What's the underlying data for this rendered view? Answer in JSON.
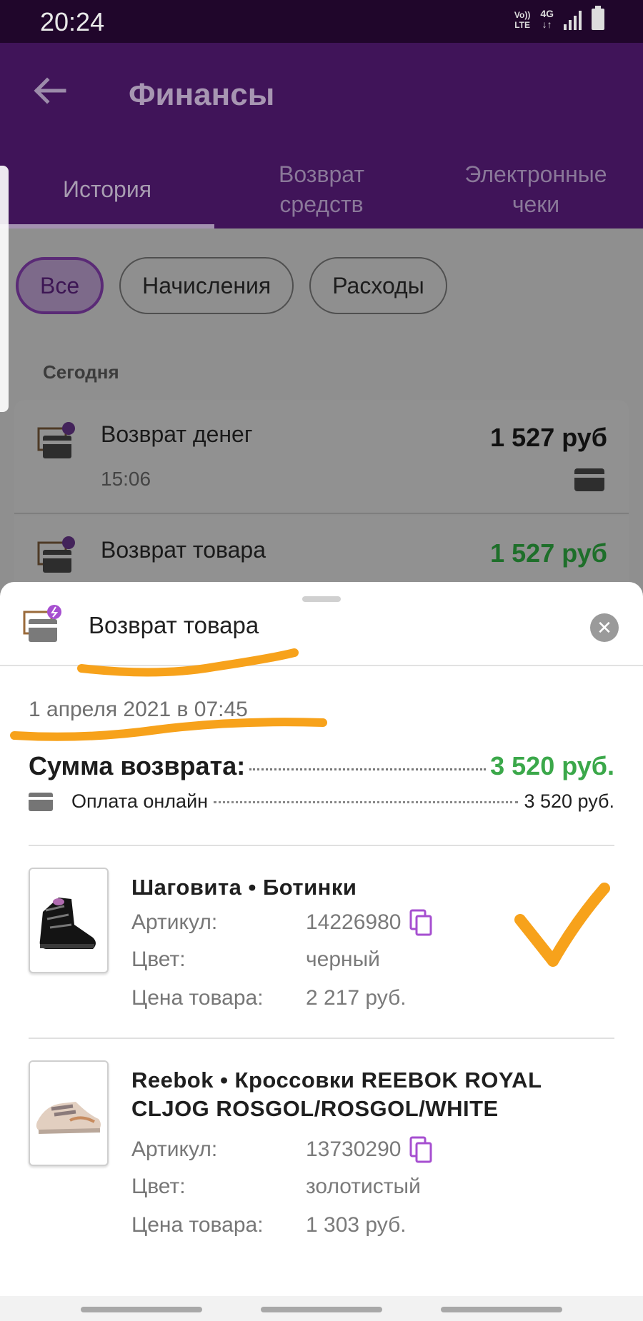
{
  "status_bar": {
    "time": "20:24",
    "volte_top": "Vo))",
    "volte_bottom": "LTE",
    "network": "4G",
    "network_arrows": "↓↑"
  },
  "app_bar": {
    "back_icon": "arrow-left-icon",
    "title": "Финансы",
    "tabs": [
      {
        "label": "История",
        "active": true
      },
      {
        "label": "Возврат средств",
        "active": false
      },
      {
        "label": "Электронные чеки",
        "active": false
      }
    ]
  },
  "filters": {
    "chips": [
      {
        "label": "Все",
        "active": true
      },
      {
        "label": "Начисления",
        "active": false
      },
      {
        "label": "Расходы",
        "active": false
      }
    ]
  },
  "history": {
    "section_label": "Сегодня",
    "transactions": [
      {
        "title": "Возврат денег",
        "time": "15:06",
        "amount": "1 527 руб"
      },
      {
        "title": "Возврат товара",
        "amount": "1 527 руб"
      }
    ]
  },
  "sheet": {
    "title": "Возврат товара",
    "close_icon": "close-icon",
    "date": "1 апреля 2021 в 07:45",
    "sum_label": "Сумма возврата:",
    "sum_value": "3 520 руб.",
    "payment_label": "Оплата онлайн",
    "payment_value": "3 520 руб.",
    "items": [
      {
        "name": "Шаговита • Ботинки",
        "article_label": "Артикул:",
        "article": "14226980",
        "color_label": "Цвет:",
        "color": "черный",
        "price_label": "Цена товара:",
        "price": "2 217 руб."
      },
      {
        "name": "Reebok • Кроссовки  REEBOK ROYAL CLJOG  ROSGOL/ROSGOL/WHITE",
        "article_label": "Артикул:",
        "article": "13730290",
        "color_label": "Цвет:",
        "color": "золотистый",
        "price_label": "Цена товара:",
        "price": "1 303 руб."
      }
    ]
  },
  "colors": {
    "app_bar": "#401459",
    "accent_purple": "#a64fd0",
    "refund_green": "#3ba84a",
    "annotation_orange": "#f7a21b"
  }
}
